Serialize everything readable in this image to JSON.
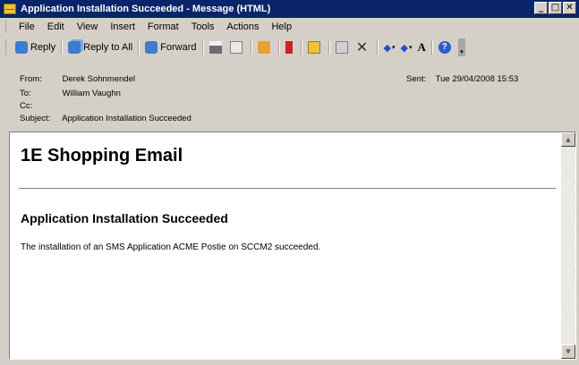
{
  "window": {
    "title": "Application Installation Succeeded - Message (HTML)",
    "buttons": {
      "minimize": "_",
      "maximize": "□",
      "close": "✕"
    }
  },
  "menu": {
    "items": [
      {
        "label": "File"
      },
      {
        "label": "Edit"
      },
      {
        "label": "View"
      },
      {
        "label": "Insert"
      },
      {
        "label": "Format"
      },
      {
        "label": "Tools"
      },
      {
        "label": "Actions"
      },
      {
        "label": "Help"
      }
    ]
  },
  "toolbar": {
    "reply_label": "Reply",
    "reply_all_label": "Reply to All",
    "forward_label": "Forward",
    "icons": [
      "reply-icon",
      "reply-all-icon",
      "forward-icon",
      "print-icon",
      "copy-icon",
      "move-icon",
      "flag-icon",
      "folder-icon",
      "rules-icon",
      "delete-icon",
      "up-arrow-icon",
      "down-arrow-icon",
      "font-size-icon",
      "help-icon"
    ],
    "help_glyph": "?",
    "font_glyph": "A",
    "delete_glyph": "✕",
    "up_glyph": "◆",
    "down_glyph": "◆",
    "dropdown_glyph": "▾"
  },
  "header": {
    "from_label": "From:",
    "from_value": "Derek Sohnmendel",
    "to_label": "To:",
    "to_value": "William Vaughn",
    "cc_label": "Cc:",
    "cc_value": "",
    "subject_label": "Subject:",
    "subject_value": "Application Installation Succeeded",
    "sent_label": "Sent:",
    "sent_value": "Tue 29/04/2008 15:53"
  },
  "message": {
    "title": "1E Shopping Email",
    "heading": "Application Installation Succeeded",
    "body": "The installation of an SMS Application ACME Postie on SCCM2 succeeded."
  },
  "scrollbar": {
    "up_glyph": "▲",
    "down_glyph": "▼"
  },
  "colors": {
    "titlebar": "#0a246a",
    "chrome": "#d4d0c8"
  }
}
